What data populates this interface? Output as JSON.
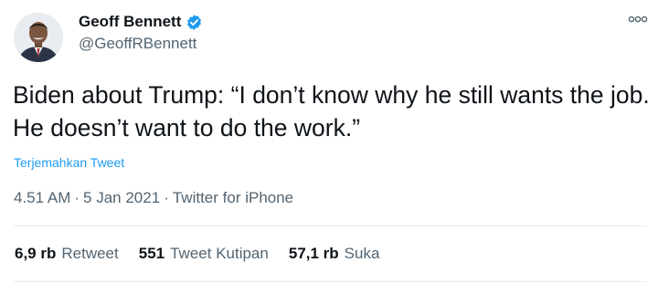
{
  "author": {
    "display_name": "Geoff Bennett",
    "handle": "@GeoffRBennett",
    "verified": true,
    "avatar_icon": "profile-photo"
  },
  "menu_icon": "more-options-icon",
  "tweet": {
    "text": "Biden about Trump: “I don’t know why he still wants the job. He doesn’t want to do the work.”",
    "translate_label": "Terjemahkan Tweet"
  },
  "meta": {
    "time": "4.51 AM",
    "date": "5 Jan 2021",
    "separator": "·",
    "source": "Twitter for iPhone"
  },
  "stats": {
    "retweets": {
      "count": "6,9 rb",
      "label": "Retweet"
    },
    "quotes": {
      "count": "551",
      "label": "Tweet Kutipan"
    },
    "likes": {
      "count": "57,1 rb",
      "label": "Suka"
    }
  },
  "colors": {
    "link": "#1d9bf0",
    "secondary_text": "#536471",
    "primary_text": "#0f1419",
    "verified_badge": "#1d9bf0"
  }
}
